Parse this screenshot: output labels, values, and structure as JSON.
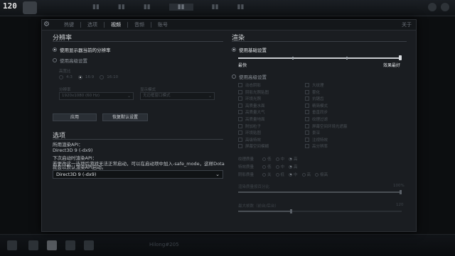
{
  "hud": {
    "fps": "120"
  },
  "panel": {
    "tabs": [
      "热键",
      "选项",
      "视频",
      "音频",
      "账号"
    ],
    "active_tab": 2,
    "close_label": "关于",
    "resolution": {
      "title": "分辨率",
      "use_display_res": "使用显示器当前的分辨率",
      "use_advanced": "使用高级设置",
      "aspect_label": "高宽比",
      "aspect_options": [
        "4:3",
        "16:9",
        "16:10"
      ],
      "res_label": "分辨率",
      "res_value": "1920x1080 (60 Hz)",
      "display_mode_label": "显示模式",
      "display_mode_value": "无边框窗口模式",
      "apply_button": "应用",
      "reset_button": "恢复默认设置"
    },
    "options": {
      "title": "选项",
      "api_label": "所用渲染API：",
      "api_value": "Direct3D 9 (-dx9)",
      "next_api_label": "下次启动时渲染API：",
      "note_line1": "若更改这一选项后游戏无法正常启动，可以在启动项中加入-safe_mode，这样Dota",
      "note_line2": "就会以默认渲染API启动。",
      "api_dropdown": "Direct3D 9 (-dx9)"
    },
    "render": {
      "title": "渲染",
      "use_basic": "使用基础设置",
      "slider_min": "最快",
      "slider_max": "效果最好",
      "basic_slider_level": 1.0,
      "use_advanced": "使用高级设置",
      "checkboxes_left": [
        "动态阴影",
        "阴影光照贴图",
        "环境光照",
        "高质量水面",
        "高质量大气",
        "高质量地面",
        "附加粒子",
        "环境贴图",
        "高级特效",
        "屏幕空间模糊"
      ],
      "checkboxes_right": [
        "大纹理",
        "雾化",
        "抗锯齿",
        "精简模式",
        "垂直同步",
        "纹理过滤",
        "屏幕空间环境光遮蔽",
        "景深",
        "注视特效",
        "高分辨率"
      ],
      "texture_quality": {
        "label": "纹理质量",
        "options": [
          "低",
          "中",
          "高"
        ],
        "selected": 2
      },
      "effects_quality": {
        "label": "特效质量",
        "options": [
          "低",
          "中",
          "高"
        ],
        "selected": 2
      },
      "shadow_quality": {
        "label": "阴影质量",
        "options": [
          "关",
          "低",
          "中",
          "高"
        ],
        "selected": 2,
        "extra": "极高"
      },
      "render_scale": {
        "label": "渲染质量按百分比",
        "value": "100%",
        "level": 1.0
      },
      "max_fps": {
        "label": "最大帧数（前台/后台）",
        "value": "120",
        "level": 0.33
      }
    }
  },
  "bottom": {
    "text": "Hilong#205"
  }
}
